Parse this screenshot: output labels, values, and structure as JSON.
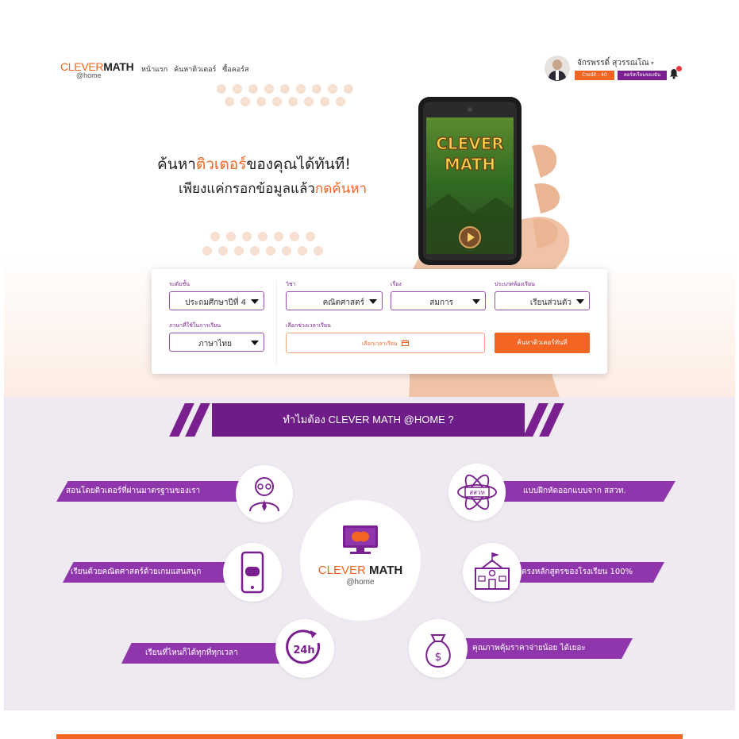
{
  "brand": {
    "logo_word1": "CLEVER",
    "logo_word2": "MATH",
    "logo_sub": "@home",
    "primary": "#f26522",
    "accent": "#7a1f8f"
  },
  "nav": {
    "items": [
      "หน้าแรก",
      "ค้นหาติวเตอร์",
      "ซื้อคอร์ส"
    ]
  },
  "user": {
    "name": "จักรพรรดิ์ สุวรรณโณ",
    "credit": "Credit : 40",
    "my_courses": "คอร์สเรียนของฉัน",
    "notification_icon": "bell-icon"
  },
  "hero": {
    "line1_a": "ค้นหา",
    "line1_b": "ติวเตอร์",
    "line1_c": "ของคุณได้ทันที!",
    "line2_a": "เพียงแค่กรอกข้อมูลแล้ว",
    "line2_b": "กดค้นหา",
    "phone_logo_1": "CLEVER",
    "phone_logo_2": "MATH"
  },
  "search": {
    "level_label": "ระดับชั้น",
    "level_value": "ประถมศึกษาปีที่ 4",
    "subject_label": "วิชา",
    "subject_value": "คณิตศาสตร์",
    "topic_label": "เรื่อง",
    "topic_value": "สมการ",
    "room_label": "ประเภทห้องเรียน",
    "room_value": "เรียนส่วนตัว",
    "language_label": "ภาษาที่ใช้ในการเรียน",
    "language_value": "ภาษาไทย",
    "time_label": "เลือกช่วงเวลาเรียน",
    "time_placeholder": "เลือกเวลาเรียน",
    "submit": "ค้นหาติวเตอร์ทันที"
  },
  "why": {
    "title": "ทำไมต้อง CLEVER MATH @HOME ?",
    "features": [
      "สอนโดยติวเตอร์ที่ผ่านมาตรฐานของเรา",
      "แบบฝึกหัดออกแบบจาก สสวท.",
      "เรียนด้วยคณิตศาสตร์ด้วยเกมแสนสนุก",
      "ตรงหลักสูตรของโรงเรียน 100%",
      "เรียนที่ไหนก็ได้ทุกที่ทุกเวลา",
      "คุณภาพคุ้มราคาจ่ายน้อย ได้เยอะ"
    ],
    "badge_ipst": "สสวท",
    "badge_24h": "24h",
    "center_logo_1": "CLEVER",
    "center_logo_2": "MATH",
    "center_logo_sub": "@home"
  }
}
